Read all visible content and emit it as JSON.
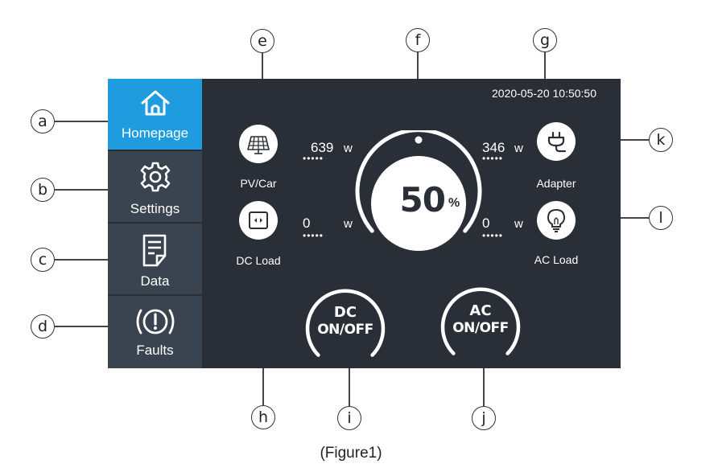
{
  "datetime": "2020-05-20 10:50:50",
  "sidebar": {
    "items": [
      {
        "label": "Homepage",
        "icon": "home-icon",
        "active": true
      },
      {
        "label": "Settings",
        "icon": "gear-icon",
        "active": false
      },
      {
        "label": "Data",
        "icon": "document-icon",
        "active": false
      },
      {
        "label": "Faults",
        "icon": "fault-alert-icon",
        "active": false
      }
    ]
  },
  "devices": {
    "pv": {
      "label": "PV/Car",
      "icon": "solar-panel-icon",
      "power": "639",
      "unit": "w"
    },
    "dc_load": {
      "label": "DC Load",
      "icon": "dc-socket-icon",
      "power": "0",
      "unit": "w"
    },
    "adapter": {
      "label": "Adapter",
      "icon": "plug-icon",
      "power": "346",
      "unit": "w"
    },
    "ac_load": {
      "label": "AC Load",
      "icon": "lightbulb-icon",
      "power": "0",
      "unit": "w"
    }
  },
  "battery": {
    "value": "50",
    "unit": "%"
  },
  "controls": {
    "dc": {
      "line1": "DC",
      "line2": "ON/OFF"
    },
    "ac": {
      "line1": "AC",
      "line2": "ON/OFF"
    }
  },
  "callouts": [
    "a",
    "b",
    "c",
    "d",
    "e",
    "f",
    "g",
    "h",
    "i",
    "j",
    "k",
    "l"
  ],
  "caption": "(Figure1)",
  "colors": {
    "screen_bg": "#2a2f37",
    "sidebar_bg": "#3a4350",
    "active_tab": "#1f9be0",
    "text": "#ffffff"
  }
}
